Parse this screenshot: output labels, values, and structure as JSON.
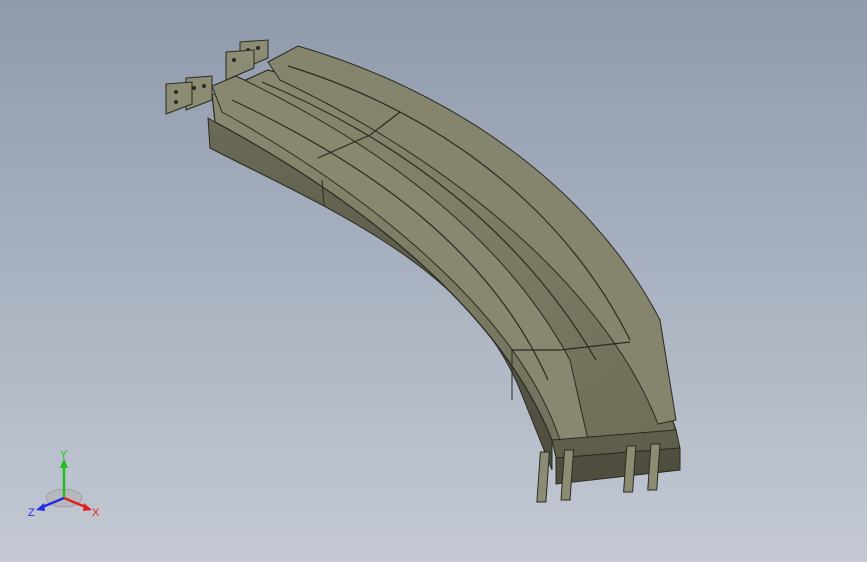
{
  "viewport": {
    "background_top": "#8f9aab",
    "background_bottom": "#c4c9d3"
  },
  "model": {
    "description_icon": "curved-busbar-track-model",
    "body_color": "#7b7a63",
    "edge_color": "#2a2a22",
    "highlight_color": "#9a9a80"
  },
  "triad": {
    "x_label": "X",
    "y_label": "Y",
    "z_label": "Z",
    "x_color": "#e02020",
    "y_color": "#20c020",
    "z_color": "#2030e0"
  }
}
